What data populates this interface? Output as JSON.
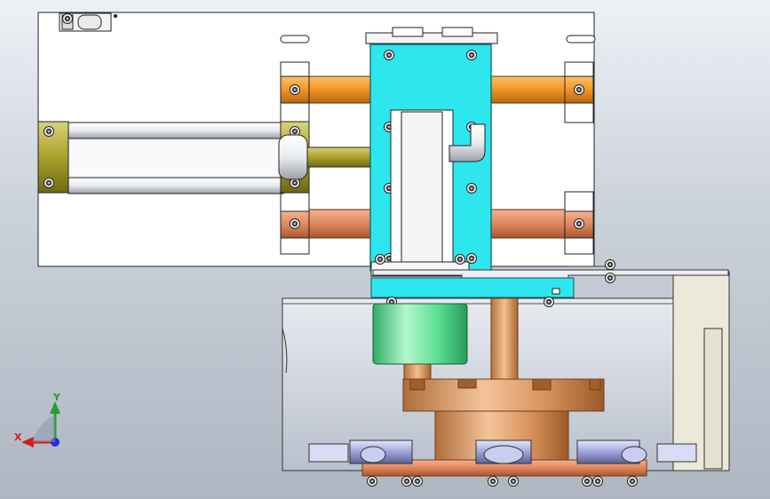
{
  "viewport": {
    "background_top": "#eef1f6",
    "background_bottom": "#aeb6c2"
  },
  "triad": {
    "x_label": "X",
    "y_label": "Y",
    "x_color": "#d21c1c",
    "y_color": "#1fa12b",
    "z_color": "#1d2fd6"
  },
  "colors": {
    "rod_orange": "#f39a2a",
    "rod_copper": "#e0865c",
    "bracket_olive": "#c9b93a",
    "slide_cyan": "#2ee6ee",
    "motor_green": "#55d98e",
    "flange_bronze": "#d99a64",
    "plate_white": "#ffffff",
    "enclosure_grey": "#c9d0dc"
  }
}
